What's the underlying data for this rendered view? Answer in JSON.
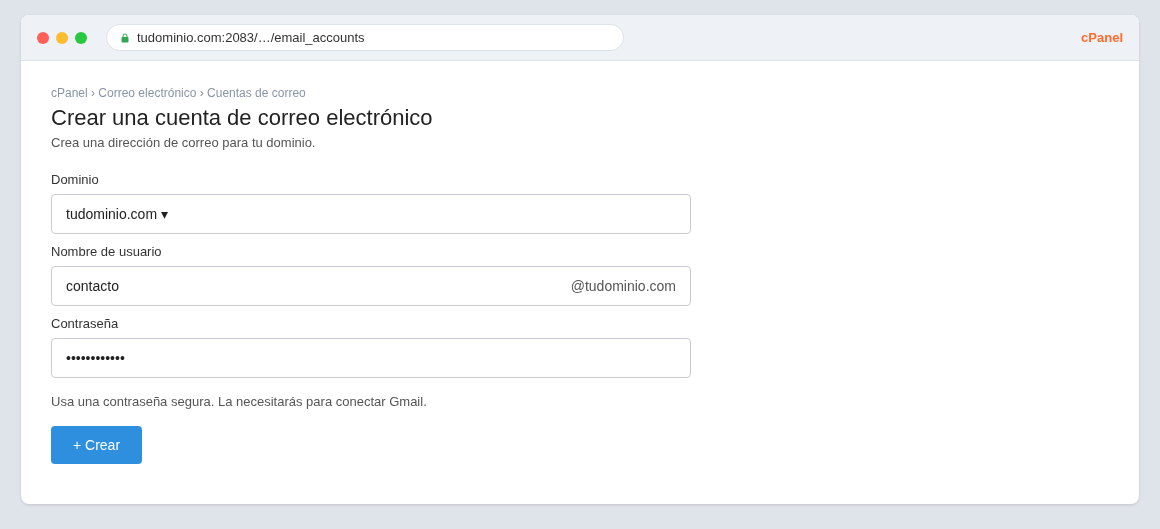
{
  "browser": {
    "url": "tudominio.com:2083/…/email_accounts",
    "brand": "cPanel"
  },
  "breadcrumb": "cPanel › Correo electrónico › Cuentas de correo",
  "title": "Crear una cuenta de correo electrónico",
  "subtitle": "Crea una dirección de correo para tu dominio.",
  "fields": [
    {
      "kind": "select",
      "label": "Dominio",
      "value": "tudominio.com",
      "caret": "▾"
    },
    {
      "kind": "suffix",
      "label": "Nombre de usuario",
      "value": "contacto",
      "suffix": "@tudominio.com"
    },
    {
      "kind": "password",
      "label": "Contraseña",
      "value": "••••••••••••"
    }
  ],
  "hint": "Usa una contraseña segura. La necesitarás para conectar Gmail.",
  "button": "+ Crear"
}
